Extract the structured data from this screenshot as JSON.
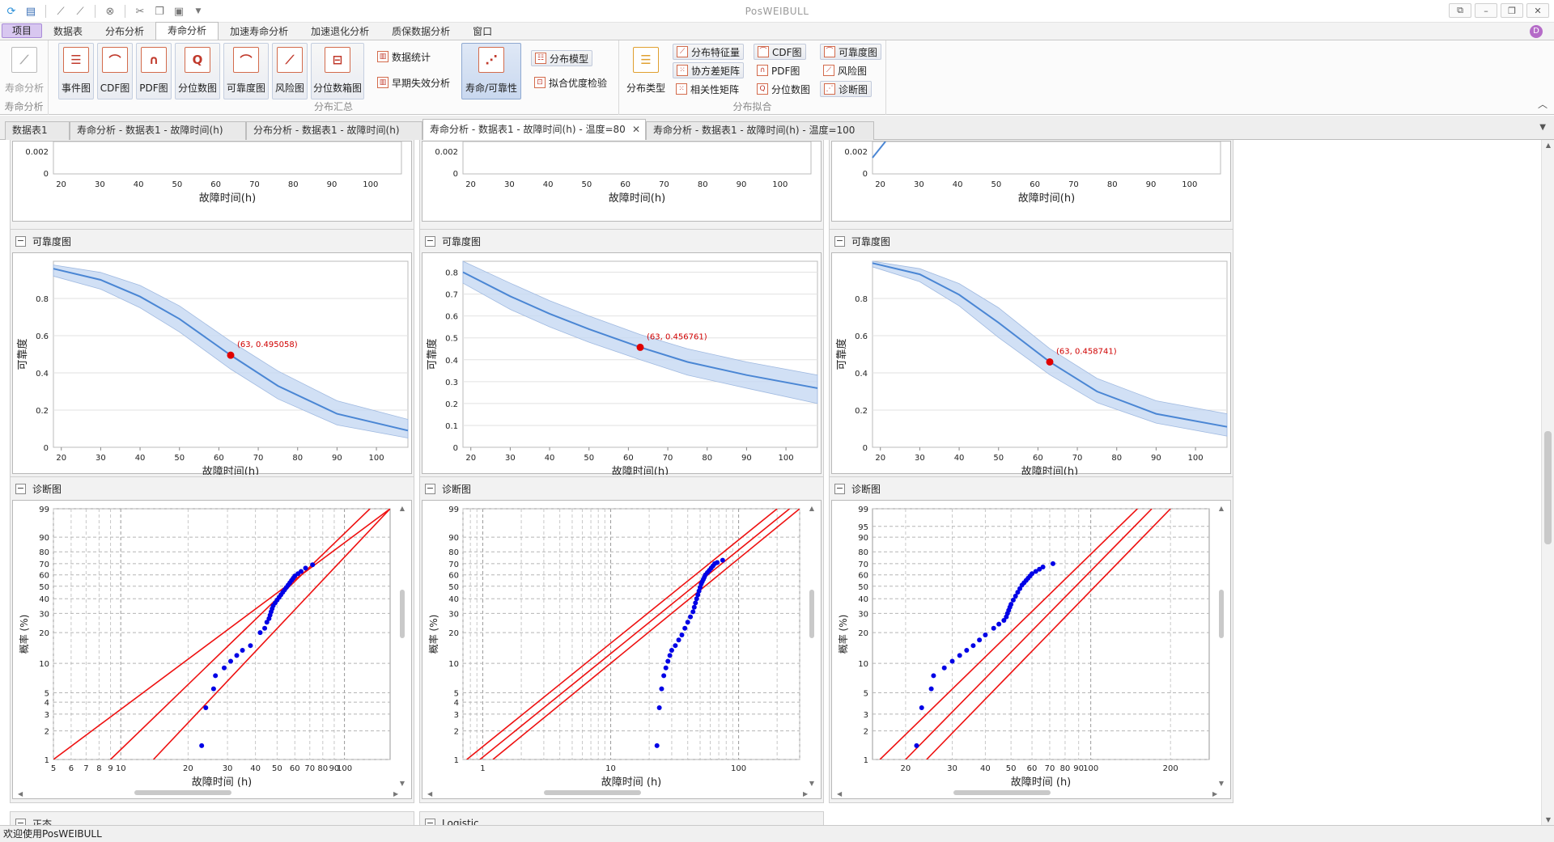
{
  "app": {
    "title": "PosWEIBULL",
    "status_text": "欢迎使用PosWEIBULL"
  },
  "quick_access": {
    "icons": [
      "refresh-icon",
      "save-icon",
      "line-chart-icon",
      "area-chart-icon",
      "stop-icon",
      "cut-icon",
      "copy-icon",
      "paste-icon",
      "dropdown-icon"
    ]
  },
  "menu": {
    "tabs": [
      {
        "label": "项目",
        "kind": "project"
      },
      {
        "label": "数据表",
        "kind": "normal"
      },
      {
        "label": "分布分析",
        "kind": "normal"
      },
      {
        "label": "寿命分析",
        "kind": "active"
      },
      {
        "label": "加速寿命分析",
        "kind": "normal"
      },
      {
        "label": "加速退化分析",
        "kind": "normal"
      },
      {
        "label": "质保数据分析",
        "kind": "normal"
      },
      {
        "label": "窗口",
        "kind": "normal"
      }
    ]
  },
  "ribbon": {
    "group1": {
      "label": "寿命分析",
      "button": "寿命分析"
    },
    "group2": {
      "label": "分布汇总",
      "buttons": [
        "事件图",
        "CDF图",
        "PDF图",
        "分位数图",
        "可靠度图",
        "风险图",
        "分位数箱图"
      ],
      "small": [
        "数据统计",
        "早期失效分析"
      ],
      "life_button": "寿命/可靠性",
      "dist_model": "分布模型",
      "goodness": "拟合优度检验"
    },
    "group3": {
      "label": "分布拟合",
      "dist_type": "分布类型",
      "col1": [
        "分布特征量",
        "协方差矩阵",
        "相关性矩阵"
      ],
      "col2": [
        "CDF图",
        "PDF图",
        "分位数图"
      ],
      "col3": [
        "可靠度图",
        "风险图",
        "诊断图"
      ]
    }
  },
  "doc_tabs": [
    {
      "label": "数据表1",
      "active": false
    },
    {
      "label": "寿命分析 - 数据表1 - 故障时间(h)",
      "active": false
    },
    {
      "label": "分布分析 - 数据表1 - 故障时间(h)",
      "active": false
    },
    {
      "label": "寿命分析 - 数据表1 - 故障时间(h) - 温度=80",
      "active": true
    },
    {
      "label": "寿命分析 - 数据表1 - 故障时间(h) - 温度=100",
      "active": false
    }
  ],
  "panels": {
    "reliability_title": "可靠度图",
    "diagnostic_title": "诊断图",
    "next_left": "正态",
    "next_mid": "Logistic"
  },
  "axes": {
    "x_label": "故障时间(h)",
    "x_label_diag": "故障时间 (h)",
    "y_reliability": "可靠度",
    "y_probability": "概率 (%)"
  },
  "chart_data": [
    {
      "type": "line",
      "panel": "left-top-partial",
      "x": [
        20,
        30,
        40,
        50,
        60,
        70,
        80,
        90,
        100
      ],
      "y_ticks": [
        "0.002",
        "0"
      ],
      "xlabel": "故障时间(h)"
    },
    {
      "type": "line",
      "panel": "mid-top-partial",
      "x": [
        20,
        30,
        40,
        50,
        60,
        70,
        80,
        90,
        100
      ],
      "y_ticks": [
        "0.002",
        "0"
      ],
      "xlabel": "故障时间(h)"
    },
    {
      "type": "line",
      "panel": "right-top-partial",
      "x": [
        20,
        30,
        40,
        50,
        60,
        70,
        80,
        90,
        100
      ],
      "y_ticks": [
        "0.002",
        "0"
      ],
      "xlabel": "故障时间(h)"
    },
    {
      "type": "line",
      "panel": "left-reliability",
      "xlim": [
        18,
        108
      ],
      "ylim": [
        0,
        1
      ],
      "x_ticks": [
        20,
        30,
        40,
        50,
        60,
        70,
        80,
        90,
        100
      ],
      "y_ticks": [
        0,
        0.2,
        0.4,
        0.6,
        0.8
      ],
      "curve": {
        "x": [
          18,
          30,
          40,
          50,
          63,
          75,
          90,
          108
        ],
        "y": [
          0.96,
          0.9,
          0.81,
          0.69,
          0.495,
          0.33,
          0.18,
          0.09
        ]
      },
      "upper": {
        "x": [
          18,
          30,
          40,
          50,
          63,
          75,
          90,
          108
        ],
        "y": [
          0.98,
          0.94,
          0.87,
          0.76,
          0.57,
          0.41,
          0.25,
          0.15
        ]
      },
      "lower": {
        "x": [
          18,
          30,
          40,
          50,
          63,
          75,
          90,
          108
        ],
        "y": [
          0.92,
          0.85,
          0.75,
          0.62,
          0.42,
          0.26,
          0.12,
          0.05
        ]
      },
      "point": {
        "x": 63,
        "y": 0.495058,
        "label": "(63, 0.495058)"
      },
      "xlabel": "故障时间(h)",
      "ylabel": "可靠度"
    },
    {
      "type": "line",
      "panel": "mid-reliability",
      "xlim": [
        18,
        108
      ],
      "ylim": [
        0,
        0.85
      ],
      "x_ticks": [
        20,
        30,
        40,
        50,
        60,
        70,
        80,
        90,
        100
      ],
      "y_ticks": [
        0,
        0.1,
        0.2,
        0.3,
        0.4,
        0.5,
        0.6,
        0.7,
        0.8
      ],
      "curve": {
        "x": [
          18,
          30,
          40,
          50,
          63,
          75,
          90,
          108
        ],
        "y": [
          0.8,
          0.69,
          0.61,
          0.54,
          0.457,
          0.39,
          0.33,
          0.27
        ]
      },
      "upper": {
        "x": [
          18,
          30,
          40,
          50,
          63,
          75,
          90,
          108
        ],
        "y": [
          0.85,
          0.75,
          0.67,
          0.6,
          0.515,
          0.45,
          0.39,
          0.33
        ]
      },
      "lower": {
        "x": [
          18,
          30,
          40,
          50,
          63,
          75,
          90,
          108
        ],
        "y": [
          0.75,
          0.63,
          0.55,
          0.48,
          0.4,
          0.33,
          0.27,
          0.2
        ]
      },
      "point": {
        "x": 63,
        "y": 0.456761,
        "label": "(63, 0.456761)"
      },
      "xlabel": "故障时间(h)",
      "ylabel": "可靠度"
    },
    {
      "type": "line",
      "panel": "right-reliability",
      "xlim": [
        18,
        108
      ],
      "ylim": [
        0,
        1
      ],
      "x_ticks": [
        20,
        30,
        40,
        50,
        60,
        70,
        80,
        90,
        100
      ],
      "y_ticks": [
        0,
        0.2,
        0.4,
        0.6,
        0.8
      ],
      "curve": {
        "x": [
          18,
          30,
          40,
          50,
          63,
          75,
          90,
          108
        ],
        "y": [
          0.99,
          0.93,
          0.82,
          0.67,
          0.459,
          0.3,
          0.18,
          0.11
        ]
      },
      "upper": {
        "x": [
          18,
          30,
          40,
          50,
          63,
          75,
          90,
          108
        ],
        "y": [
          1.0,
          0.96,
          0.88,
          0.75,
          0.53,
          0.37,
          0.25,
          0.18
        ]
      },
      "lower": {
        "x": [
          18,
          30,
          40,
          50,
          63,
          75,
          90,
          108
        ],
        "y": [
          0.97,
          0.89,
          0.76,
          0.59,
          0.39,
          0.24,
          0.13,
          0.06
        ]
      },
      "point": {
        "x": 63,
        "y": 0.458741,
        "label": "(63, 0.458741)"
      },
      "xlabel": "故障时间(h)",
      "ylabel": "可靠度"
    },
    {
      "type": "scatter",
      "panel": "left-diagnostic",
      "xscale": "log",
      "xlim": [
        5,
        160
      ],
      "x_ticks": [
        "5",
        "6",
        "7",
        "8",
        "9",
        "10",
        "20",
        "30",
        "40",
        "50",
        "60",
        "70",
        "80",
        "90",
        "100"
      ],
      "x_tick_values": [
        5,
        6,
        7,
        8,
        9,
        10,
        20,
        30,
        40,
        50,
        60,
        70,
        80,
        90,
        100
      ],
      "y_ticks": [
        "1",
        "2",
        "3",
        "4",
        "5",
        "10",
        "20",
        "30",
        "40",
        "50",
        "60",
        "70",
        "80",
        "90",
        "99"
      ],
      "points": {
        "x": [
          23,
          24,
          26,
          26.5,
          29,
          31,
          33,
          35,
          38,
          42,
          44,
          45,
          46,
          46.5,
          47,
          47.5,
          48,
          49,
          50,
          51,
          52,
          53,
          54,
          55,
          56,
          57,
          58,
          59,
          60,
          62,
          64,
          67,
          72
        ],
        "y": [
          1.4,
          3.5,
          5.5,
          7.5,
          9,
          10.5,
          12,
          13.5,
          15,
          20,
          22,
          25,
          27,
          29,
          31,
          33,
          35,
          37,
          39,
          41,
          43,
          45,
          47,
          49,
          51,
          53,
          55,
          57,
          59,
          61,
          63,
          66,
          69
        ]
      },
      "lines": [
        {
          "x": [
            5,
            160
          ],
          "y": [
            1,
            99
          ]
        },
        {
          "x": [
            9,
            130
          ],
          "y": [
            1,
            99
          ]
        },
        {
          "x": [
            14,
            160
          ],
          "y": [
            1,
            99
          ]
        }
      ],
      "xlabel": "故障时间 (h)",
      "ylabel": "概率 (%)"
    },
    {
      "type": "scatter",
      "panel": "mid-diagnostic",
      "xscale": "log",
      "xlim": [
        0.7,
        300
      ],
      "x_ticks": [
        "1",
        "10",
        "100"
      ],
      "x_tick_values": [
        1,
        10,
        100
      ],
      "y_ticks": [
        "1",
        "2",
        "3",
        "4",
        "5",
        "10",
        "20",
        "30",
        "40",
        "50",
        "60",
        "70",
        "80",
        "90",
        "99"
      ],
      "points": {
        "x": [
          23,
          24,
          25,
          26,
          27,
          28,
          29,
          30,
          32,
          34,
          36,
          38,
          40,
          42,
          44,
          45,
          46,
          47,
          48,
          49,
          50,
          51,
          52,
          53,
          54,
          55,
          57,
          59,
          61,
          63,
          65,
          68,
          75
        ],
        "y": [
          1.4,
          3.5,
          5.5,
          7.5,
          9,
          10.5,
          12,
          13.5,
          15,
          17,
          19,
          22,
          25,
          28,
          31,
          34,
          37,
          40,
          43,
          46,
          49,
          52,
          54,
          56,
          58,
          60,
          62,
          64,
          66,
          68,
          70,
          71,
          73
        ]
      },
      "lines": [
        {
          "x": [
            0.75,
            200
          ],
          "y": [
            1,
            99
          ]
        },
        {
          "x": [
            0.95,
            250
          ],
          "y": [
            1,
            99
          ]
        },
        {
          "x": [
            1.2,
            300
          ],
          "y": [
            1,
            99
          ]
        }
      ],
      "xlabel": "故障时间 (h)",
      "ylabel": "概率 (%)"
    },
    {
      "type": "scatter",
      "panel": "right-diagnostic",
      "xscale": "log",
      "xlim": [
        15,
        280
      ],
      "x_ticks": [
        "20",
        "30",
        "40",
        "50",
        "60",
        "70",
        "80",
        "90",
        "100",
        "200"
      ],
      "x_tick_values": [
        20,
        30,
        40,
        50,
        60,
        70,
        80,
        90,
        100,
        200
      ],
      "y_ticks": [
        "1",
        "2",
        "3",
        "5",
        "10",
        "20",
        "30",
        "40",
        "50",
        "60",
        "70",
        "80",
        "90",
        "95",
        "99"
      ],
      "points": {
        "x": [
          22,
          23,
          25,
          25.5,
          28,
          30,
          32,
          34,
          36,
          38,
          40,
          43,
          45,
          47,
          48,
          48.5,
          49,
          49.5,
          50,
          51,
          52,
          53,
          54,
          55,
          56,
          57,
          58,
          59,
          60,
          62,
          64,
          66,
          72
        ],
        "y": [
          1.4,
          3.5,
          5.5,
          7.5,
          9,
          10.5,
          12,
          13.5,
          15,
          17,
          19,
          22,
          24,
          26,
          28,
          30,
          32,
          34,
          36,
          39,
          42,
          45,
          48,
          51,
          53,
          55,
          57,
          59,
          61,
          63,
          65,
          67,
          70
        ]
      },
      "lines": [
        {
          "x": [
            16,
            150
          ],
          "y": [
            1,
            99
          ]
        },
        {
          "x": [
            20,
            170
          ],
          "y": [
            1,
            99
          ]
        },
        {
          "x": [
            24,
            200
          ],
          "y": [
            1,
            99
          ]
        }
      ],
      "xlabel": "故障时间 (h)",
      "ylabel": "概率 (%)"
    }
  ],
  "colors": {
    "curve": "#4a86d4",
    "band": "#c6d8f2",
    "point": "#e00000",
    "diag_point": "#0000e6",
    "diag_line": "#ee1111",
    "label_red": "#d00000"
  }
}
